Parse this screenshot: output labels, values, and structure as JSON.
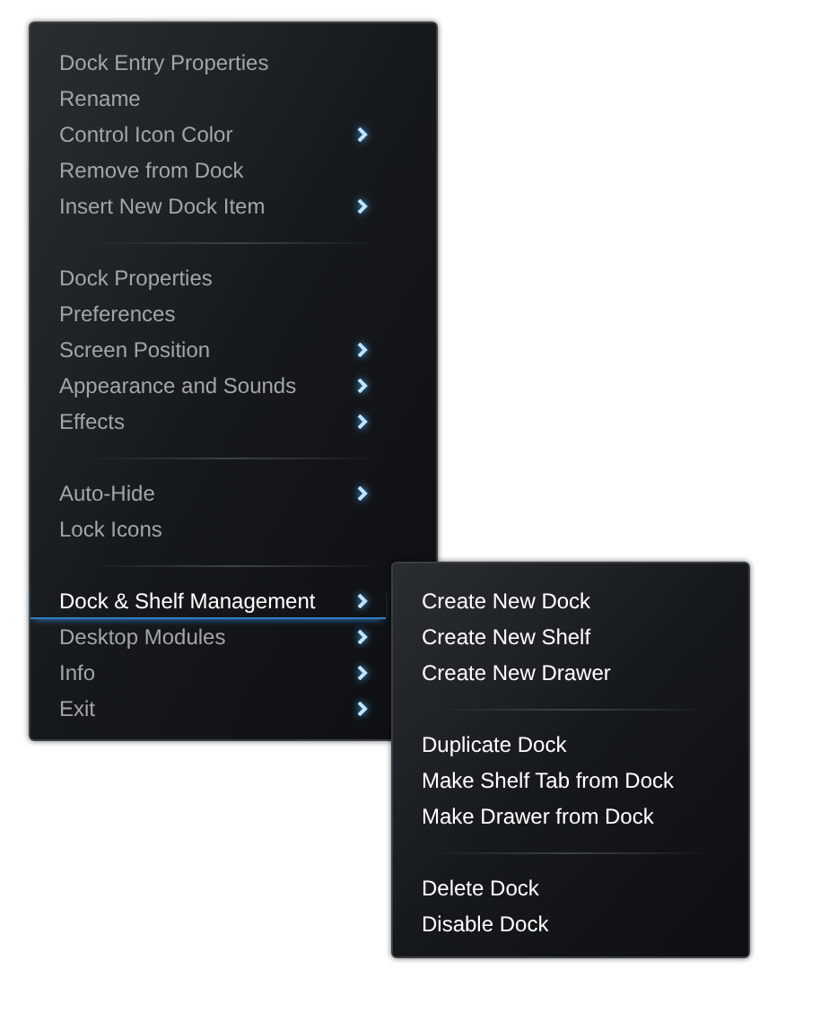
{
  "menu": {
    "groups": [
      [
        {
          "label": "Dock Entry Properties",
          "submenu": false,
          "selected": false
        },
        {
          "label": "Rename",
          "submenu": false,
          "selected": false
        },
        {
          "label": "Control Icon Color",
          "submenu": true,
          "selected": false
        },
        {
          "label": "Remove from Dock",
          "submenu": false,
          "selected": false
        },
        {
          "label": "Insert New Dock Item",
          "submenu": true,
          "selected": false
        }
      ],
      [
        {
          "label": "Dock Properties",
          "submenu": false,
          "selected": false
        },
        {
          "label": "Preferences",
          "submenu": false,
          "selected": false
        },
        {
          "label": "Screen Position",
          "submenu": true,
          "selected": false
        },
        {
          "label": "Appearance and Sounds",
          "submenu": true,
          "selected": false
        },
        {
          "label": "Effects",
          "submenu": true,
          "selected": false
        }
      ],
      [
        {
          "label": "Auto-Hide",
          "submenu": true,
          "selected": false
        },
        {
          "label": "Lock Icons",
          "submenu": false,
          "selected": false
        }
      ],
      [
        {
          "label": "Dock & Shelf Management",
          "submenu": true,
          "selected": true
        },
        {
          "label": "Desktop Modules",
          "submenu": true,
          "selected": false
        },
        {
          "label": "Info",
          "submenu": true,
          "selected": false
        },
        {
          "label": "Exit",
          "submenu": true,
          "selected": false
        }
      ]
    ]
  },
  "submenu": {
    "groups": [
      [
        {
          "label": "Create New Dock"
        },
        {
          "label": "Create New Shelf"
        },
        {
          "label": "Create New Drawer"
        }
      ],
      [
        {
          "label": "Duplicate Dock"
        },
        {
          "label": "Make Shelf Tab from Dock"
        },
        {
          "label": "Make Drawer from Dock"
        }
      ],
      [
        {
          "label": "Delete Dock"
        },
        {
          "label": "Disable Dock"
        }
      ]
    ]
  }
}
